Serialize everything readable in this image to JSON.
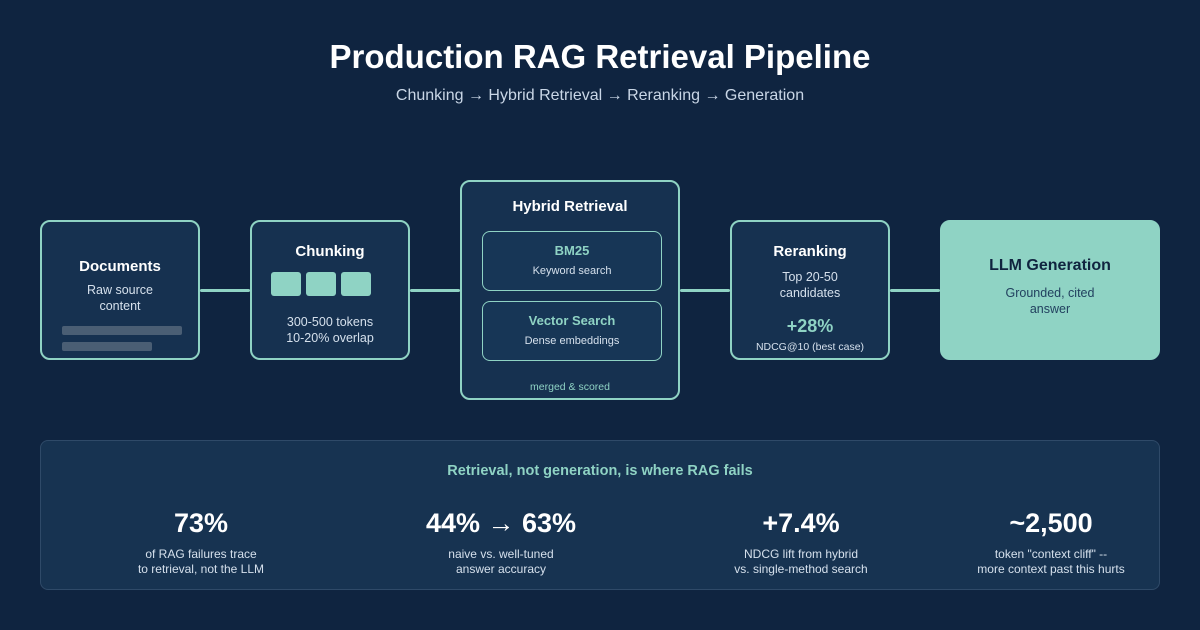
{
  "title": "Production RAG Retrieval Pipeline",
  "subtitle": "Chunking → Hybrid Retrieval → Reranking → Generation",
  "colors": {
    "background": "#0f2440",
    "accent": "#8fd3c4",
    "card": "#163150"
  },
  "stages": {
    "documents": {
      "title": "Documents",
      "text_lines": [
        "Raw source",
        "content"
      ]
    },
    "chunking": {
      "title": "Chunking",
      "text_lines": [
        "300-500 tokens",
        "10-20% overlap"
      ]
    },
    "hybrid": {
      "title": "Hybrid Retrieval",
      "bm25": {
        "title": "BM25",
        "text": "Keyword search"
      },
      "vector": {
        "title": "Vector Search",
        "text": "Dense embeddings"
      },
      "footer": "merged & scored"
    },
    "reranking": {
      "title": "Reranking",
      "text_lines": [
        "Top 20-50",
        "candidates"
      ],
      "stat": "+28%",
      "stat_label": "NDCG@10 (best case)"
    },
    "llm": {
      "title": "LLM Generation",
      "text_lines": [
        "Grounded, cited",
        "answer"
      ]
    }
  },
  "summary": {
    "heading": "Retrieval, not generation, is where RAG fails",
    "metrics": [
      {
        "value": "73%",
        "desc_lines": [
          "of RAG failures trace",
          "to retrieval, not the LLM"
        ]
      },
      {
        "value": "44% → 63%",
        "desc_lines": [
          "naive vs. well-tuned",
          "answer accuracy"
        ]
      },
      {
        "value": "+7.4%",
        "desc_lines": [
          "NDCG lift from hybrid",
          "vs. single-method search"
        ]
      },
      {
        "value": "~2,500",
        "desc_lines": [
          "token \"context cliff\" --",
          "more context past this hurts"
        ]
      }
    ]
  }
}
